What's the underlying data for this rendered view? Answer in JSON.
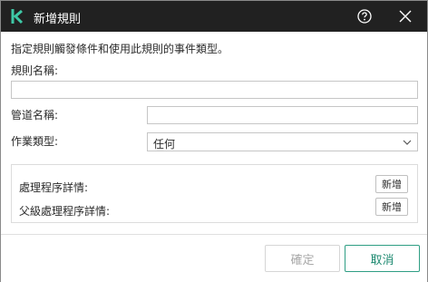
{
  "window": {
    "title": "新增規則",
    "logo": "kaspersky-k-logo"
  },
  "form": {
    "description": "指定規則觸發條件和使用此規則的事件類型。",
    "rule_name_label": "規則名稱:",
    "rule_name_value": "",
    "pipe_name_label": "管道名稱:",
    "pipe_name_value": "",
    "operation_type_label": "作業類型:",
    "operation_type_value": "任何"
  },
  "details": {
    "process_label": "處理程序詳情:",
    "process_add": "新增",
    "parent_process_label": "父級處理程序詳情:",
    "parent_process_add": "新增"
  },
  "footer": {
    "ok_label": "確定",
    "cancel_label": "取消"
  },
  "colors": {
    "titlebar": "#212121",
    "accent": "#1f8a71",
    "logo": "#3ec8a6"
  }
}
